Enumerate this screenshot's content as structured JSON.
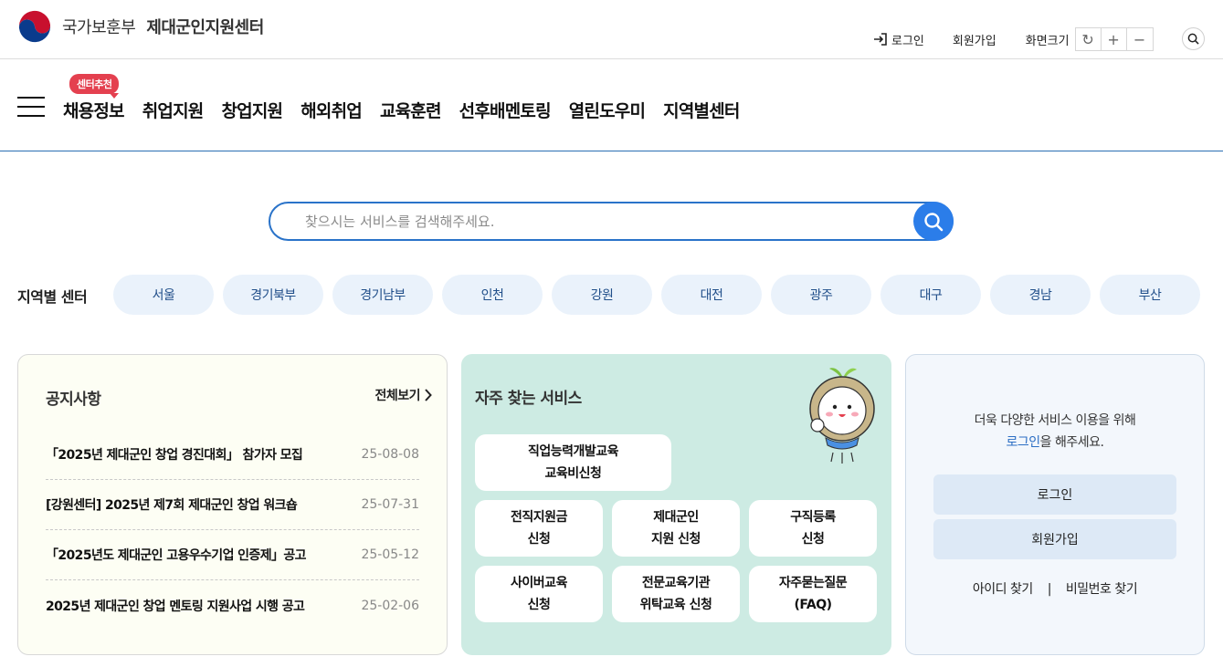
{
  "header": {
    "org_name": "국가보훈부",
    "center_name": "제대군인지원센터",
    "login_label": "로그인",
    "join_label": "회원가입",
    "zoom_label": "화면크기",
    "zoom_reset": "↻",
    "zoom_in": "+",
    "zoom_out": "−"
  },
  "gnb": {
    "badge": "센터추천",
    "items": [
      "채용정보",
      "취업지원",
      "창업지원",
      "해외취업",
      "교육훈련",
      "선후배멘토링",
      "열린도우미",
      "지역별센터"
    ]
  },
  "search": {
    "placeholder": "찾으시는 서비스를 검색해주세요."
  },
  "regions": {
    "label": "지역별 센터",
    "items": [
      "서울",
      "경기북부",
      "경기남부",
      "인천",
      "강원",
      "대전",
      "광주",
      "대구",
      "경남",
      "부산"
    ]
  },
  "notice": {
    "title": "공지사항",
    "more_label": "전체보기",
    "items": [
      {
        "title": "「2025년 제대군인 창업 경진대회」 참가자 모집",
        "date": "25-08-08"
      },
      {
        "title": "[강원센터] 2025년 제7회 제대군인 창업 워크숍",
        "date": "25-07-31"
      },
      {
        "title": "「2025년도 제대군인 고용우수기업 인증제」공고",
        "date": "25-05-12"
      },
      {
        "title": "2025년 제대군인 창업 멘토링 지원사업 시행 공고",
        "date": "25-02-06"
      }
    ]
  },
  "services": {
    "title": "자주 찾는 서비스",
    "items": [
      "직업능력개발교육\n교육비신청",
      "전직지원금\n신청",
      "제대군인\n지원 신청",
      "구직등록\n신청",
      "사이버교육\n신청",
      "전문교육기관\n위탁교육 신청",
      "자주묻는질문\n(FAQ)"
    ]
  },
  "login_box": {
    "message_line1": "더욱 다양한 서비스 이용을 위해",
    "message_highlight": "로그인",
    "message_tail": "을 해주세요.",
    "login_button": "로그인",
    "join_button": "회원가입",
    "find_id": "아이디 찾기",
    "separator": "|",
    "find_pw": "비밀번호 찾기"
  },
  "colors": {
    "accent": "#2b7de9",
    "badge": "#e4404f",
    "region_bg": "#eaf2fb",
    "services_bg": "#cdebe3",
    "notice_bg": "#fdfef4",
    "login_bg": "#f3f7fc"
  }
}
